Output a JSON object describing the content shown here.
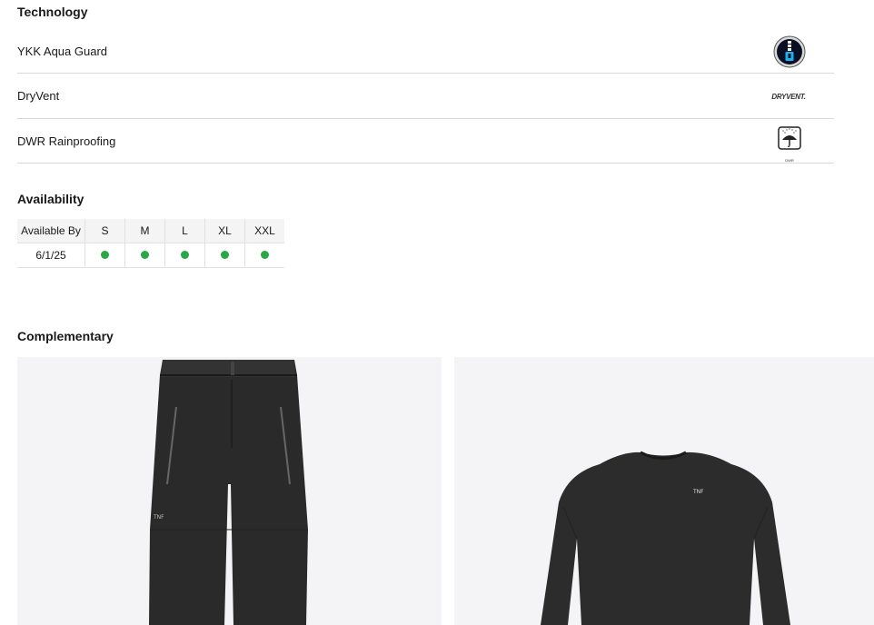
{
  "technology": {
    "title": "Technology",
    "items": [
      {
        "label": "YKK Aqua Guard",
        "icon": "zipper-badge-icon"
      },
      {
        "label": "DryVent",
        "icon": "dryvent-logo-icon",
        "logo_text": "DRYVENT."
      },
      {
        "label": "DWR Rainproofing",
        "icon": "umbrella-rain-icon",
        "logo_text": "DWR"
      }
    ]
  },
  "availability": {
    "title": "Availability",
    "headers": [
      "Available By",
      "S",
      "M",
      "L",
      "XL",
      "XXL"
    ],
    "rows": [
      {
        "date": "6/1/25",
        "status": [
          "available",
          "available",
          "available",
          "available",
          "available"
        ]
      }
    ],
    "status_color": "#28a745"
  },
  "complementary": {
    "title": "Complementary",
    "products": [
      {
        "name": "black-snow-pants",
        "image": "pants-image"
      },
      {
        "name": "black-long-sleeve-top",
        "image": "long-sleeve-top-image"
      }
    ]
  }
}
